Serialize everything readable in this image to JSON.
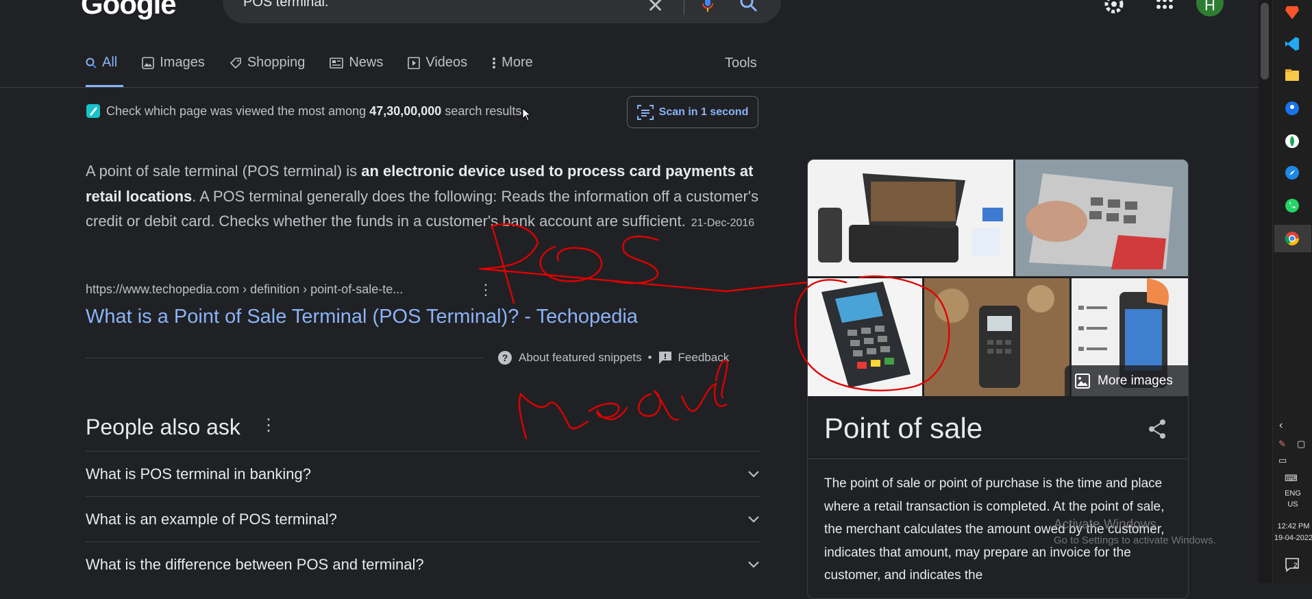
{
  "browser": {
    "logo": "Google",
    "query": "POS terminal.",
    "avatar_letter": "H"
  },
  "tabs": [
    {
      "label": "All",
      "icon": "search-icon",
      "active": true
    },
    {
      "label": "Images",
      "icon": "image-icon"
    },
    {
      "label": "Shopping",
      "icon": "tag-icon"
    },
    {
      "label": "News",
      "icon": "news-icon"
    },
    {
      "label": "Videos",
      "icon": "video-icon"
    },
    {
      "label": "More",
      "icon": "more-vert-icon"
    }
  ],
  "tools_label": "Tools",
  "promo": {
    "text_before": "Check which page was viewed the most among ",
    "count": "47,30,00,000",
    "text_after": " search results",
    "button": "Scan in 1 second"
  },
  "snippet": {
    "p1": "A point of sale terminal (POS terminal) is ",
    "bold": "an electronic device used to process card payments at retail locations",
    "p2": ". A POS terminal generally does the following: Reads the information off a customer's credit or debit card. Checks whether the funds in a customer's bank account are sufficient.",
    "date": "21-Dec-2016",
    "cite": "https://www.techopedia.com › definition › point-of-sale-te...",
    "link": "What is a Point of Sale Terminal (POS Terminal)? - Techopedia",
    "about": "About featured snippets",
    "feedback": "Feedback"
  },
  "people_also_ask": {
    "title": "People also ask",
    "questions": [
      "What is POS terminal in banking?",
      "What is an example of POS terminal?",
      "What is the difference between POS and terminal?"
    ]
  },
  "knowledge_panel": {
    "more_images": "More images",
    "title": "Point of sale",
    "description": "The point of sale or point of purchase is the time and place where a retail transaction is completed. At the point of sale, the merchant calculates the amount owed by the customer, indicates that amount, may prepare an invoice for the customer, and indicates the"
  },
  "watermark": {
    "line1": "Activate Windows",
    "line2": "Go to Settings to activate Windows."
  },
  "taskbar": {
    "lang1": "ENG",
    "lang2": "US",
    "time": "12:42 PM",
    "date": "19-04-2022",
    "notif_count": "2"
  },
  "colors": {
    "background": "#202124",
    "link": "#8ab4f8",
    "annotation": "#e00000"
  }
}
